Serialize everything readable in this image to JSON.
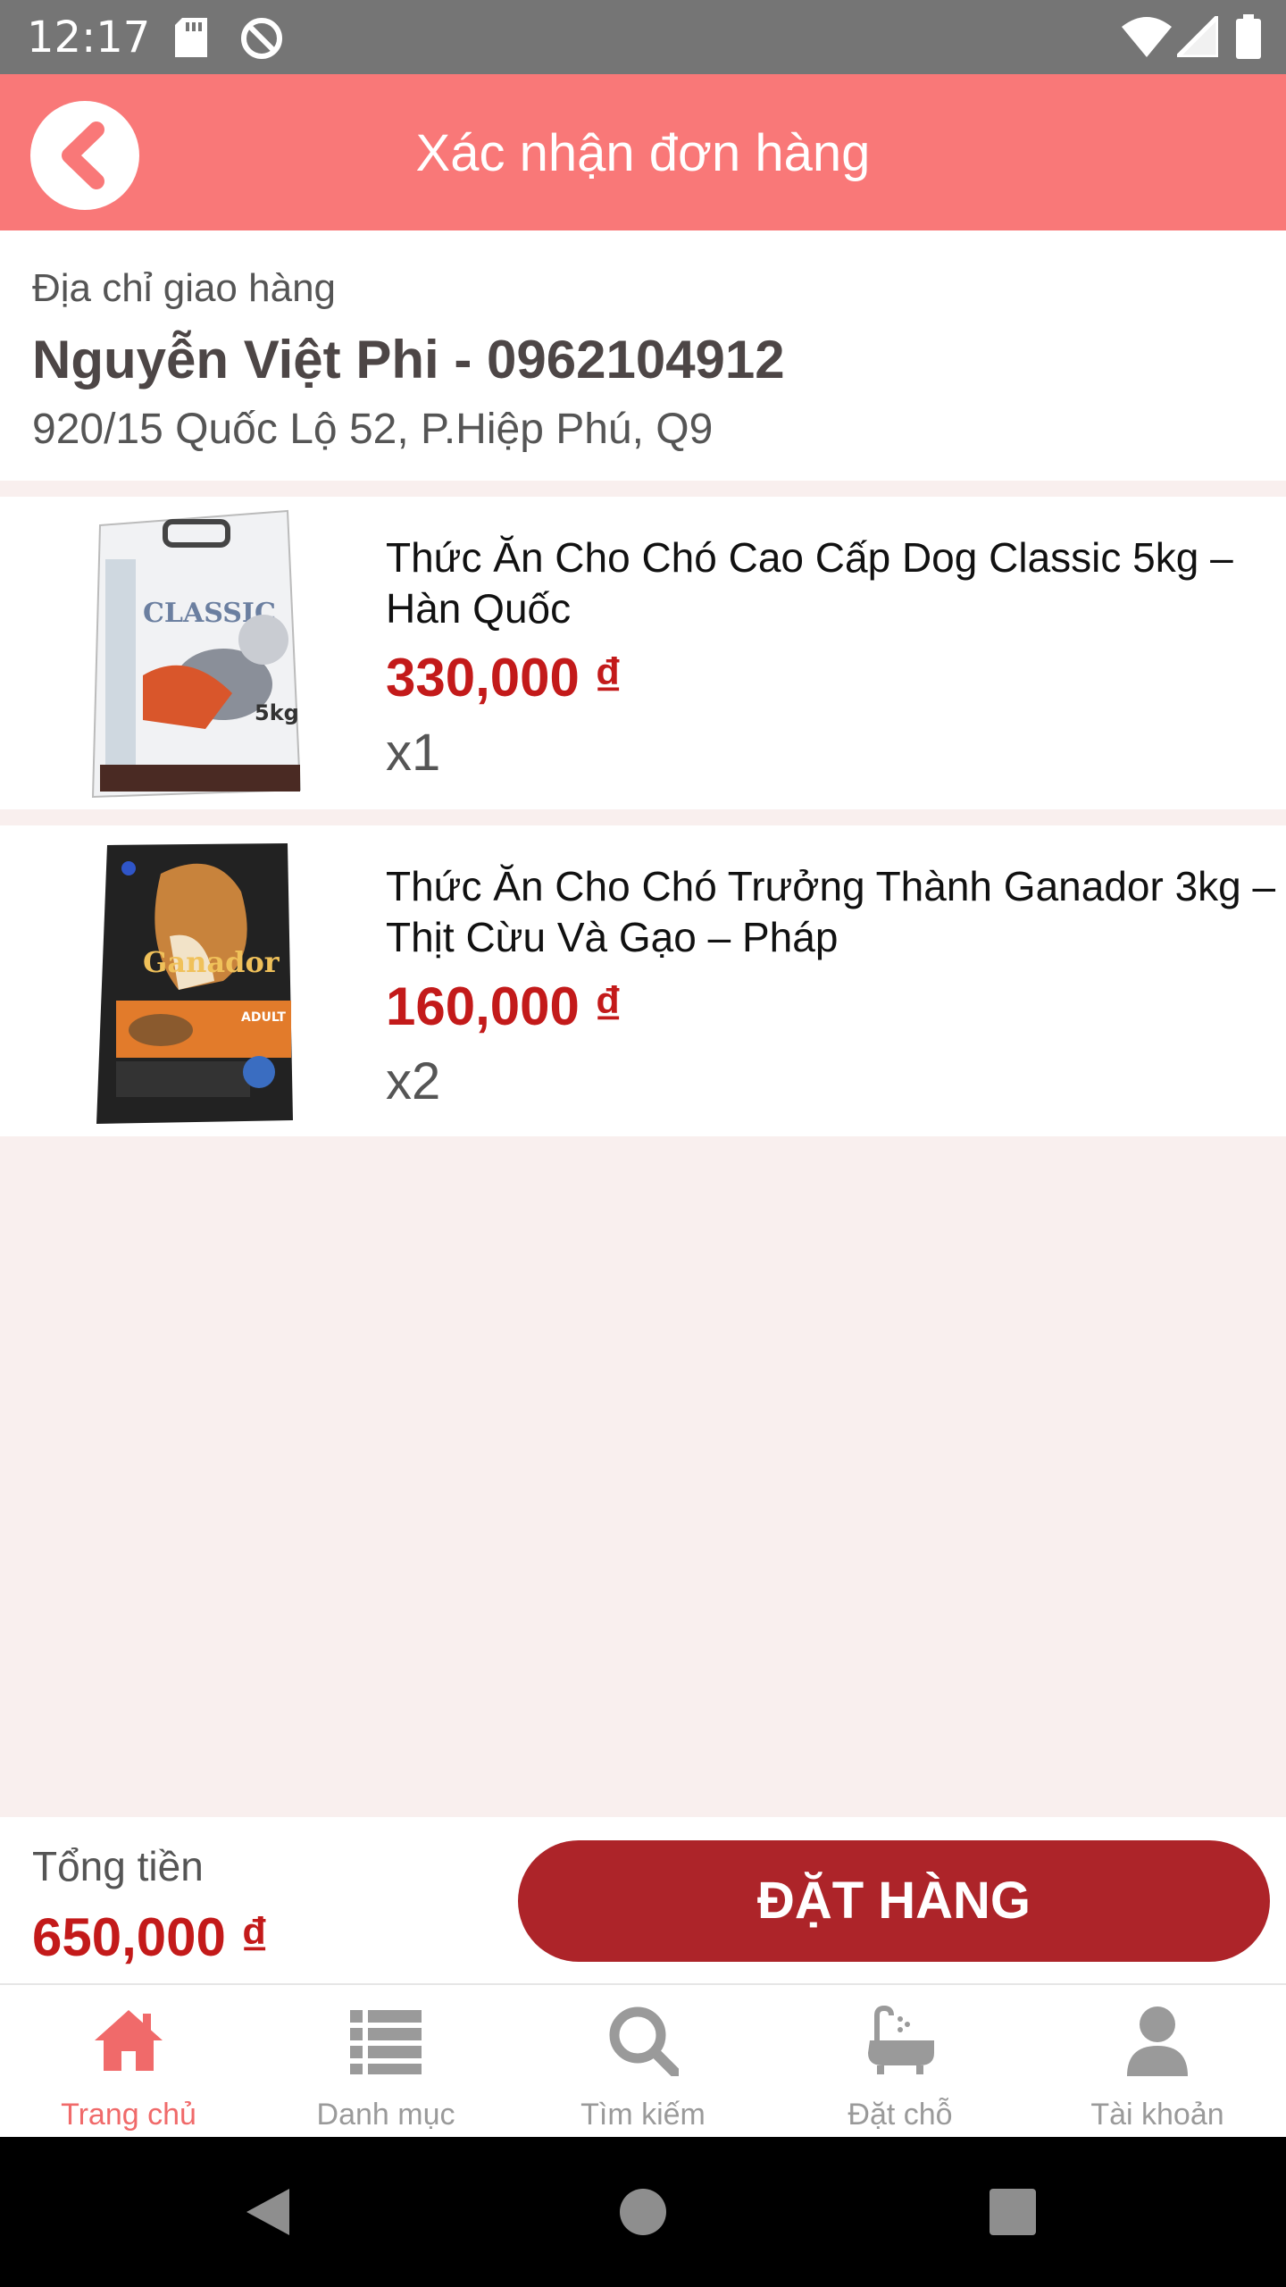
{
  "status_bar": {
    "time": "12:17",
    "icons": [
      "sd-card-icon",
      "do-not-disturb-icon",
      "wifi-icon",
      "signal-icon",
      "battery-icon"
    ]
  },
  "header": {
    "title": "Xác nhận đơn hàng",
    "back_icon": "chevron-left-icon",
    "background_color": "#f97878"
  },
  "address": {
    "label": "Địa chỉ giao hàng",
    "name_phone": "Nguyễn Việt Phi - 0962104912",
    "line": "920/15 Quốc Lộ 52, P.Hiệp Phú, Q9"
  },
  "items": [
    {
      "name": "Thức Ăn Cho Chó Cao Cấp Dog Classic 5kg – Hàn Quốc",
      "price": "330,000 ₫",
      "quantity": "x1"
    },
    {
      "name": "Thức Ăn Cho Chó Trưởng Thành Ganador 3kg – Thịt Cừu Và Gạo – Pháp",
      "price": "160,000 ₫",
      "quantity": "x2"
    }
  ],
  "summary": {
    "total_label": "Tổng tiền",
    "total_value": "650,000 ₫",
    "order_button": "ĐẶT HÀNG",
    "accent_color": "#ad2429",
    "price_color": "#c31a1a"
  },
  "tabs": [
    {
      "label": "Trang chủ",
      "icon": "home-icon",
      "active": true
    },
    {
      "label": "Danh mục",
      "icon": "list-icon",
      "active": false
    },
    {
      "label": "Tìm kiếm",
      "icon": "search-icon",
      "active": false
    },
    {
      "label": "Đặt chỗ",
      "icon": "bathtub-icon",
      "active": false
    },
    {
      "label": "Tài khoản",
      "icon": "user-icon",
      "active": false
    }
  ]
}
